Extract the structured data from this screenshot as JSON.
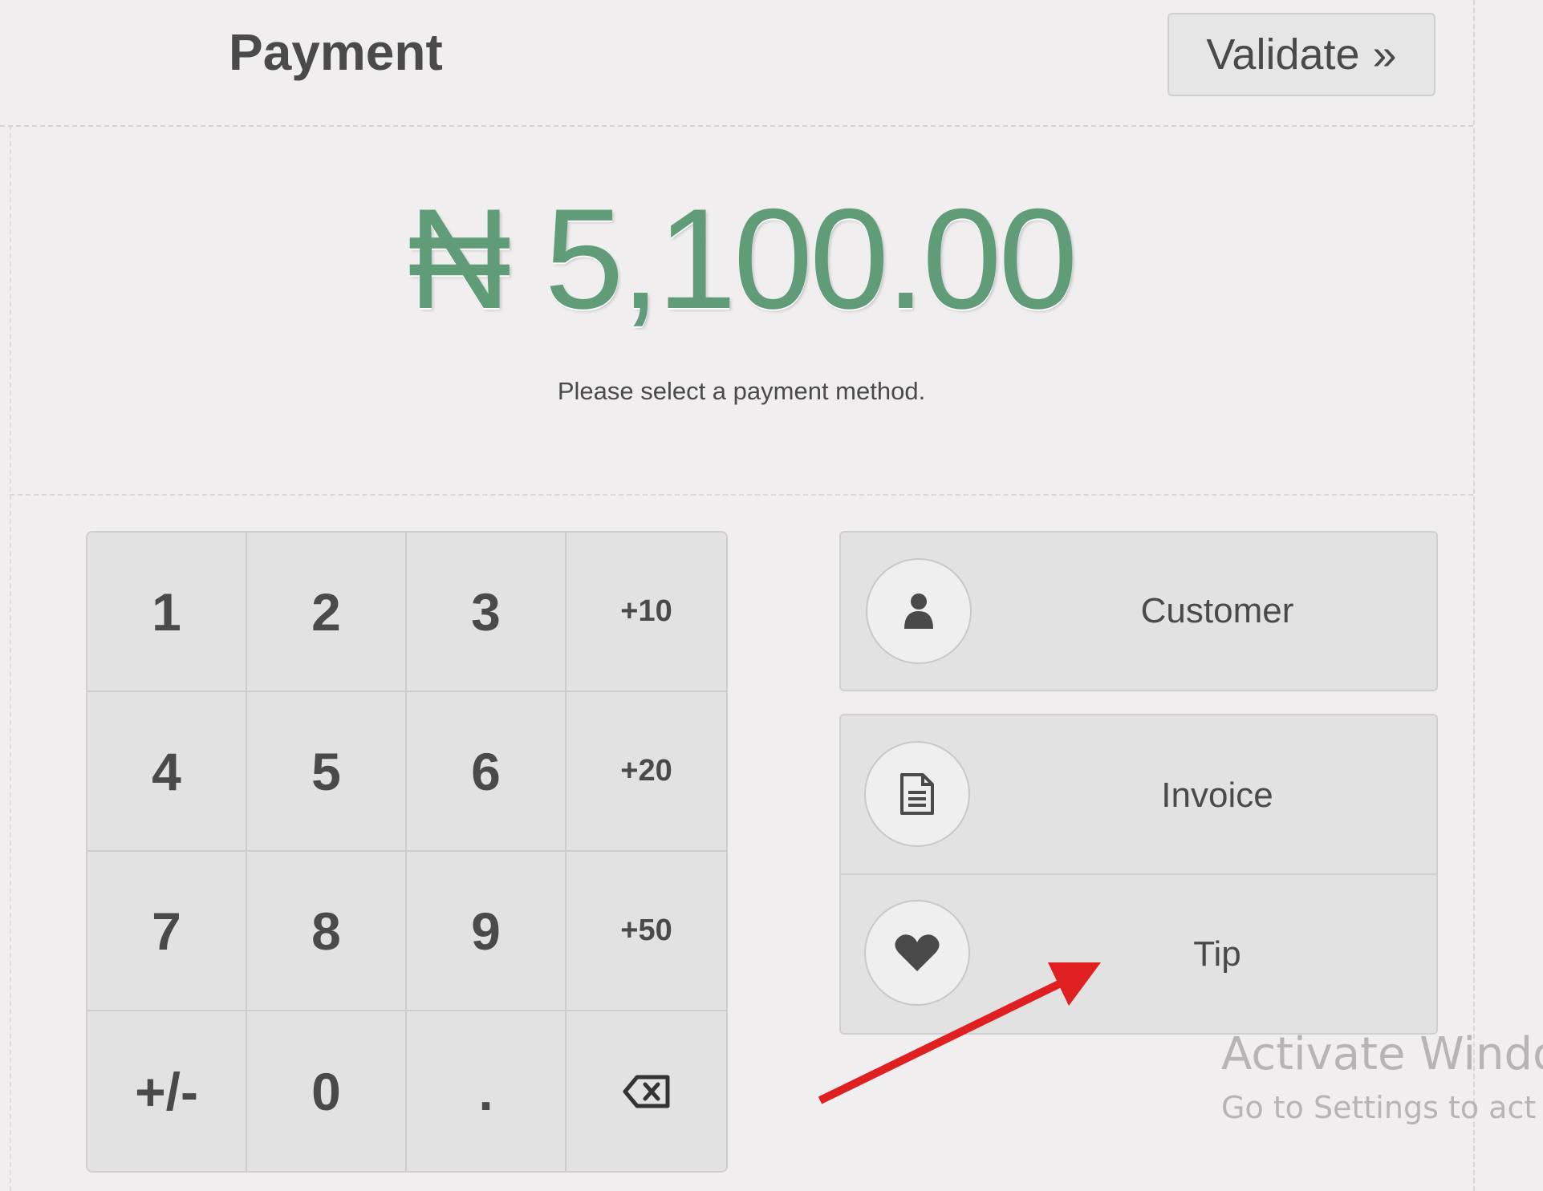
{
  "header": {
    "title": "Payment",
    "validate_label": "Validate",
    "validate_icon": "double-chevron-right-icon"
  },
  "summary": {
    "amount": "₦ 5,100.00",
    "message": "Please select a payment method."
  },
  "numpad": {
    "keys": [
      "1",
      "2",
      "3",
      "+10",
      "4",
      "5",
      "6",
      "+20",
      "7",
      "8",
      "9",
      "+50",
      "+/-",
      "0",
      ".",
      ""
    ],
    "backspace_icon": "backspace-icon"
  },
  "methods": [
    {
      "label": "Customer",
      "icon": "user-icon"
    },
    {
      "label": "Invoice",
      "icon": "document-icon"
    },
    {
      "label": "Tip",
      "icon": "heart-icon"
    }
  ],
  "watermark": {
    "line1": "Activate Windo",
    "line2": "Go to Settings to act"
  },
  "colors": {
    "amount": "#619c79",
    "background": "#f0eeee",
    "button": "#e2e2e2",
    "annotation_arrow": "#e02020"
  }
}
